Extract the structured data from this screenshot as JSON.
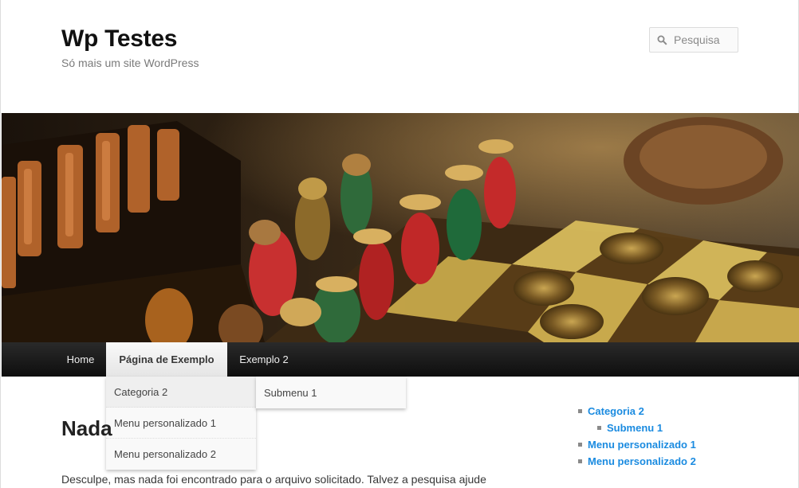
{
  "header": {
    "site_title": "Wp Testes",
    "site_description": "Só mais um site WordPress",
    "search_placeholder": "Pesquisa"
  },
  "nav": {
    "items": [
      {
        "label": "Home"
      },
      {
        "label": "Página de Exemplo"
      },
      {
        "label": "Exemplo 2"
      }
    ],
    "dropdown": [
      {
        "label": "Categoria 2"
      },
      {
        "label": "Menu personalizado 1"
      },
      {
        "label": "Menu personalizado 2"
      }
    ],
    "submenu": [
      {
        "label": "Submenu 1"
      }
    ]
  },
  "main": {
    "title": "Nada",
    "text": "Desculpe, mas nada foi encontrado para o arquivo solicitado. Talvez a pesquisa ajude"
  },
  "sidebar": {
    "links": [
      {
        "label": "Categoria 2"
      },
      {
        "label": "Submenu 1"
      },
      {
        "label": "Menu personalizado 1"
      },
      {
        "label": "Menu personalizado 2"
      }
    ]
  },
  "colors": {
    "link": "#1b8be0",
    "nav_bg": "#1a1a1a",
    "nav_active_bg": "#f0f0f0"
  }
}
